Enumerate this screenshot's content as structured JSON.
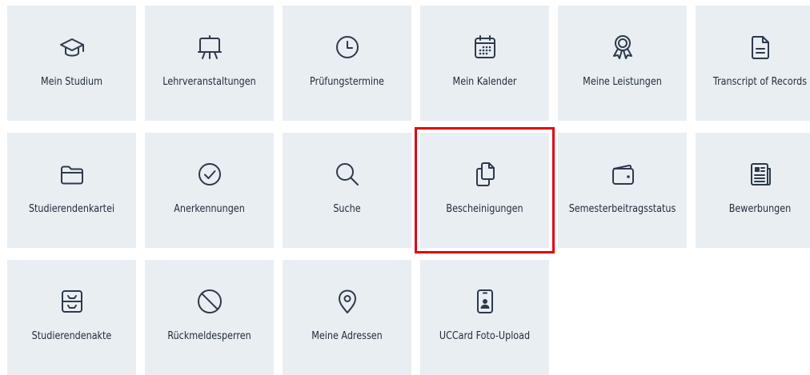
{
  "tiles": [
    {
      "id": "mein-studium",
      "label": "Mein Studium",
      "icon": "graduation-cap-icon"
    },
    {
      "id": "lehrveranstaltungen",
      "label": "Lehrveranstaltungen",
      "icon": "easel-icon"
    },
    {
      "id": "pruefungstermine",
      "label": "Prüfungstermine",
      "icon": "clock-icon"
    },
    {
      "id": "mein-kalender",
      "label": "Mein Kalender",
      "icon": "calendar-icon"
    },
    {
      "id": "meine-leistungen",
      "label": "Meine Leistungen",
      "icon": "award-ribbon-icon"
    },
    {
      "id": "transcript-of-records",
      "label": "Transcript of Records",
      "icon": "document-text-icon"
    },
    {
      "id": "studierendenkartei",
      "label": "Studierendenkartei",
      "icon": "folder-icon"
    },
    {
      "id": "anerkennungen",
      "label": "Anerkennungen",
      "icon": "check-circle-icon"
    },
    {
      "id": "suche",
      "label": "Suche",
      "icon": "search-icon"
    },
    {
      "id": "bescheinigungen",
      "label": "Bescheinigungen",
      "icon": "documents-copy-icon",
      "highlighted": true
    },
    {
      "id": "semesterbeitragsstatus",
      "label": "Semesterbeitragsstatus",
      "icon": "wallet-icon"
    },
    {
      "id": "bewerbungen",
      "label": "Bewerbungen",
      "icon": "newspaper-icon"
    },
    {
      "id": "studierendenakte",
      "label": "Studierendenakte",
      "icon": "archive-tray-icon"
    },
    {
      "id": "rueckmeldesperren",
      "label": "Rückmeldesperren",
      "icon": "ban-icon"
    },
    {
      "id": "meine-adressen",
      "label": "Meine Adressen",
      "icon": "map-pin-icon"
    },
    {
      "id": "uccard-foto-upload",
      "label": "UCCard Foto-Upload",
      "icon": "phone-photo-id-icon"
    }
  ],
  "colors": {
    "tile_background": "#e9eef3",
    "icon_color": "#2c3a4b",
    "text_color": "#1f2a3a",
    "highlight_border": "#e3000f"
  }
}
